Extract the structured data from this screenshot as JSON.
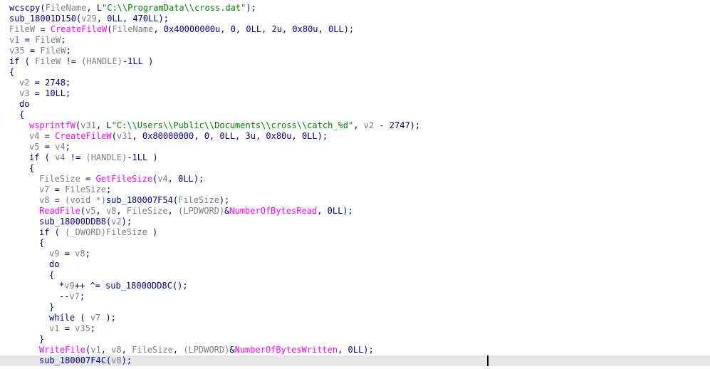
{
  "editor": {
    "lines": [
      {
        "indent": 0,
        "segments": [
          [
            "p",
            "wcscpy("
          ],
          [
            "v",
            "FileName"
          ],
          [
            "p",
            ", L"
          ],
          [
            "s",
            "\"C:\\\\ProgramData\\\\cross.dat\""
          ],
          [
            "p",
            ");"
          ]
        ]
      },
      {
        "indent": 0,
        "segments": [
          [
            "p",
            "sub_18001D150("
          ],
          [
            "v",
            "v29"
          ],
          [
            "p",
            ", 0LL, 470LL);"
          ]
        ]
      },
      {
        "indent": 0,
        "segments": [
          [
            "v",
            "FileW"
          ],
          [
            "p",
            " = "
          ],
          [
            "f",
            "CreateFileW"
          ],
          [
            "p",
            "("
          ],
          [
            "v",
            "FileName"
          ],
          [
            "p",
            ", 0x40000000u, 0, 0LL, 2u, 0x80u, 0LL);"
          ]
        ]
      },
      {
        "indent": 0,
        "segments": [
          [
            "v",
            "v1"
          ],
          [
            "p",
            " = "
          ],
          [
            "v",
            "FileW"
          ],
          [
            "p",
            ";"
          ]
        ]
      },
      {
        "indent": 0,
        "segments": [
          [
            "v",
            "v35"
          ],
          [
            "p",
            " = "
          ],
          [
            "v",
            "FileW"
          ],
          [
            "p",
            ";"
          ]
        ]
      },
      {
        "indent": 0,
        "segments": [
          [
            "p",
            "if ( "
          ],
          [
            "v",
            "FileW"
          ],
          [
            "p",
            " != "
          ],
          [
            "t",
            "(HANDLE)"
          ],
          [
            "p",
            "-1LL )"
          ]
        ]
      },
      {
        "indent": 0,
        "segments": [
          [
            "p",
            "{"
          ]
        ]
      },
      {
        "indent": 1,
        "segments": [
          [
            "v",
            "v2"
          ],
          [
            "p",
            " = 2748;"
          ]
        ]
      },
      {
        "indent": 1,
        "segments": [
          [
            "v",
            "v3"
          ],
          [
            "p",
            " = 10LL;"
          ]
        ]
      },
      {
        "indent": 1,
        "segments": [
          [
            "p",
            "do"
          ]
        ]
      },
      {
        "indent": 1,
        "segments": [
          [
            "p",
            "{"
          ]
        ]
      },
      {
        "indent": 2,
        "segments": [
          [
            "f",
            "wsprintfW"
          ],
          [
            "p",
            "("
          ],
          [
            "v",
            "v31"
          ],
          [
            "p",
            ", L"
          ],
          [
            "s",
            "\"C:\\\\Users\\\\Public\\\\Documents\\\\cross\\\\catch_%d\""
          ],
          [
            "p",
            ", "
          ],
          [
            "v",
            "v2"
          ],
          [
            "p",
            " - 2747);"
          ]
        ]
      },
      {
        "indent": 2,
        "segments": [
          [
            "v",
            "v4"
          ],
          [
            "p",
            " = "
          ],
          [
            "f",
            "CreateFileW"
          ],
          [
            "p",
            "("
          ],
          [
            "v",
            "v31"
          ],
          [
            "p",
            ", 0x80000000, 0, 0LL, 3u, 0x80u, 0LL);"
          ]
        ]
      },
      {
        "indent": 2,
        "segments": [
          [
            "v",
            "v5"
          ],
          [
            "p",
            " = "
          ],
          [
            "v",
            "v4"
          ],
          [
            "p",
            ";"
          ]
        ]
      },
      {
        "indent": 2,
        "segments": [
          [
            "p",
            "if ( "
          ],
          [
            "v",
            "v4"
          ],
          [
            "p",
            " != "
          ],
          [
            "t",
            "(HANDLE)"
          ],
          [
            "p",
            "-1LL )"
          ]
        ]
      },
      {
        "indent": 2,
        "segments": [
          [
            "p",
            "{"
          ]
        ]
      },
      {
        "indent": 3,
        "segments": [
          [
            "v",
            "FileSize"
          ],
          [
            "p",
            " = "
          ],
          [
            "f",
            "GetFileSize"
          ],
          [
            "p",
            "("
          ],
          [
            "v",
            "v4"
          ],
          [
            "p",
            ", 0LL);"
          ]
        ]
      },
      {
        "indent": 3,
        "segments": [
          [
            "v",
            "v7"
          ],
          [
            "p",
            " = "
          ],
          [
            "v",
            "FileSize"
          ],
          [
            "p",
            ";"
          ]
        ]
      },
      {
        "indent": 3,
        "segments": [
          [
            "v",
            "v8"
          ],
          [
            "p",
            " = "
          ],
          [
            "t",
            "(void *)"
          ],
          [
            "p",
            "sub_180007F54("
          ],
          [
            "v",
            "FileSize"
          ],
          [
            "p",
            ");"
          ]
        ]
      },
      {
        "indent": 3,
        "segments": [
          [
            "f",
            "ReadFile"
          ],
          [
            "p",
            "("
          ],
          [
            "v",
            "v5"
          ],
          [
            "p",
            ", "
          ],
          [
            "v",
            "v8"
          ],
          [
            "p",
            ", "
          ],
          [
            "v",
            "FileSize"
          ],
          [
            "p",
            ", "
          ],
          [
            "t",
            "(LPDWORD)"
          ],
          [
            "p",
            "&"
          ],
          [
            "g",
            "NumberOfBytesRead"
          ],
          [
            "p",
            ", 0LL);"
          ]
        ]
      },
      {
        "indent": 3,
        "segments": [
          [
            "p",
            "sub_18000DDB8("
          ],
          [
            "v",
            "v2"
          ],
          [
            "p",
            ");"
          ]
        ]
      },
      {
        "indent": 3,
        "segments": [
          [
            "p",
            "if ( "
          ],
          [
            "t",
            "(_DWORD)"
          ],
          [
            "v",
            "FileSize"
          ],
          [
            "p",
            " )"
          ]
        ]
      },
      {
        "indent": 3,
        "segments": [
          [
            "p",
            "{"
          ]
        ]
      },
      {
        "indent": 4,
        "segments": [
          [
            "v",
            "v9"
          ],
          [
            "p",
            " = "
          ],
          [
            "v",
            "v8"
          ],
          [
            "p",
            ";"
          ]
        ]
      },
      {
        "indent": 4,
        "segments": [
          [
            "p",
            "do"
          ]
        ]
      },
      {
        "indent": 4,
        "segments": [
          [
            "p",
            "{"
          ]
        ]
      },
      {
        "indent": 5,
        "segments": [
          [
            "p",
            "*"
          ],
          [
            "v",
            "v9"
          ],
          [
            "p",
            "++ ^= sub_18000DD8C();"
          ]
        ]
      },
      {
        "indent": 5,
        "segments": [
          [
            "p",
            "--"
          ],
          [
            "v",
            "v7"
          ],
          [
            "p",
            ";"
          ]
        ]
      },
      {
        "indent": 4,
        "segments": [
          [
            "p",
            "}"
          ]
        ]
      },
      {
        "indent": 4,
        "segments": [
          [
            "p",
            "while ( "
          ],
          [
            "v",
            "v7"
          ],
          [
            "p",
            " );"
          ]
        ]
      },
      {
        "indent": 4,
        "segments": [
          [
            "v",
            "v1"
          ],
          [
            "p",
            " = "
          ],
          [
            "v",
            "v35"
          ],
          [
            "p",
            ";"
          ]
        ]
      },
      {
        "indent": 3,
        "segments": [
          [
            "p",
            "}"
          ]
        ]
      },
      {
        "indent": 3,
        "segments": [
          [
            "f",
            "WriteFile"
          ],
          [
            "p",
            "("
          ],
          [
            "v",
            "v1"
          ],
          [
            "p",
            ", "
          ],
          [
            "v",
            "v8"
          ],
          [
            "p",
            ", "
          ],
          [
            "v",
            "FileSize"
          ],
          [
            "p",
            ", "
          ],
          [
            "t",
            "(LPDWORD)"
          ],
          [
            "p",
            "&"
          ],
          [
            "g",
            "NumberOfBytesWritten"
          ],
          [
            "p",
            ", 0LL);"
          ]
        ]
      },
      {
        "indent": 3,
        "segments": [
          [
            "p",
            "sub_180007F4C("
          ],
          [
            "v",
            "v8"
          ],
          [
            "p",
            ");"
          ]
        ]
      }
    ],
    "current_line_index": 33
  }
}
